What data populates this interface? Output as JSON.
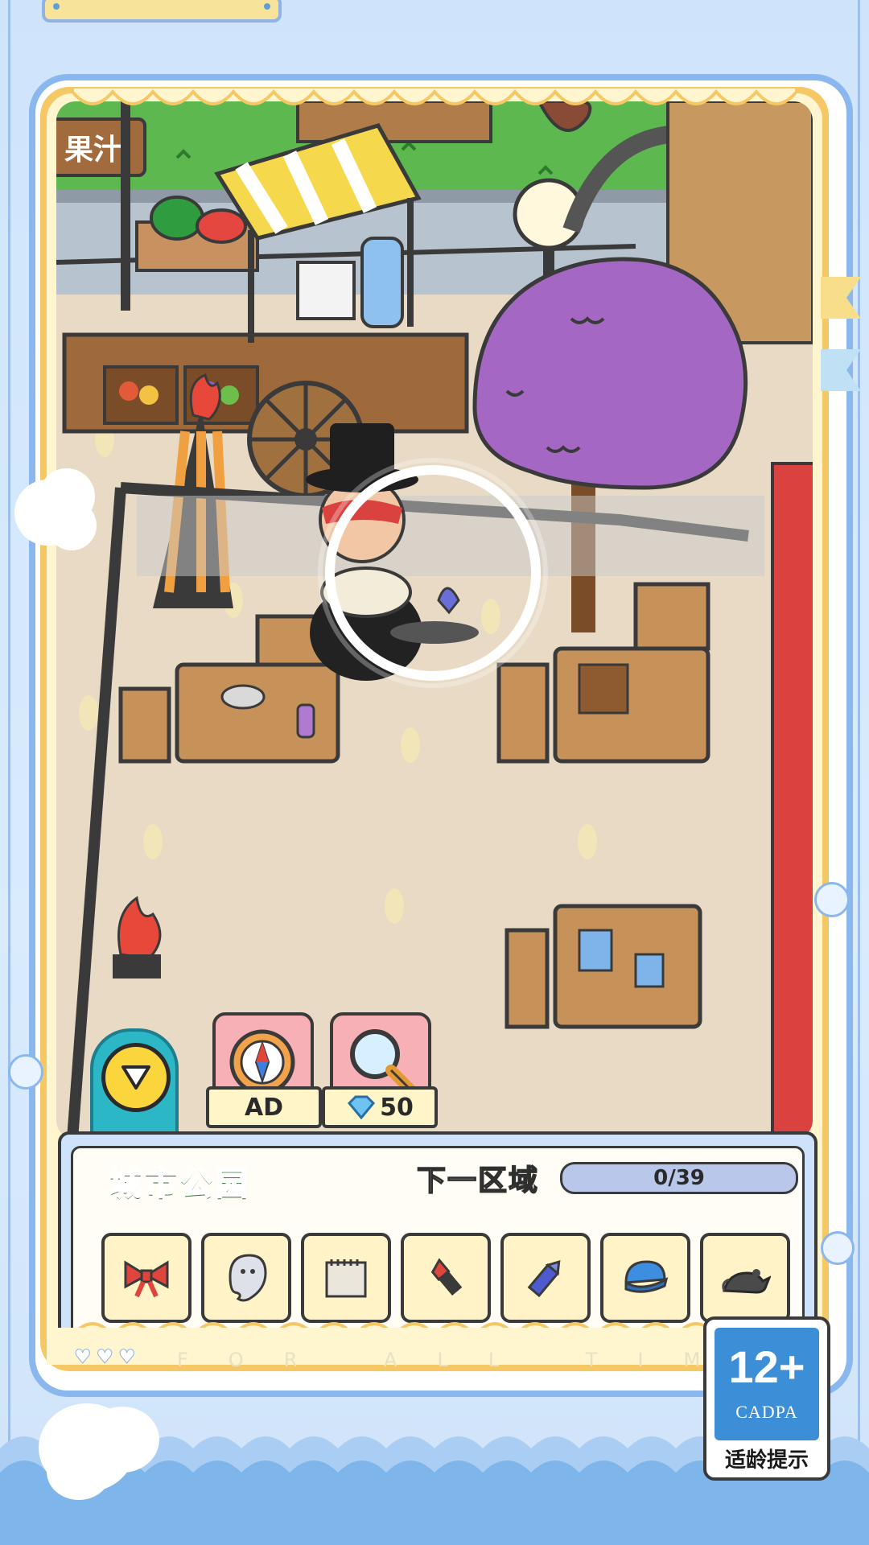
{
  "scene": {
    "sign_text": "果汁",
    "target_character": "top-hat-waiter"
  },
  "tools": [
    {
      "icon": "compass-icon",
      "label": "AD"
    },
    {
      "icon": "magnifier-icon",
      "cost_icon": "diamond-icon",
      "label": "50"
    }
  ],
  "panel": {
    "area_name": "城市公园",
    "next_area_label": "下一区域",
    "progress_text": "0/39",
    "progress_fraction": 0,
    "items": [
      {
        "icon": "bow-icon"
      },
      {
        "icon": "ghost-icon"
      },
      {
        "icon": "notepad-icon"
      },
      {
        "icon": "lipstick-icon"
      },
      {
        "icon": "crayon-icon"
      },
      {
        "icon": "cap-icon"
      },
      {
        "icon": "mouse-icon"
      }
    ]
  },
  "footer": {
    "tagline": "FOR ALL TIME"
  },
  "rating_badge": {
    "age": "12+",
    "org": "CADPA",
    "hint": "适龄提示"
  },
  "colors": {
    "frame_blue": "#8ab8ee",
    "frame_gold": "#f5c865",
    "area_green": "#48c04c",
    "badge_blue": "#3c8ed6",
    "tool_pink": "#f7b0b5",
    "tab_teal": "#2bb7c6"
  }
}
